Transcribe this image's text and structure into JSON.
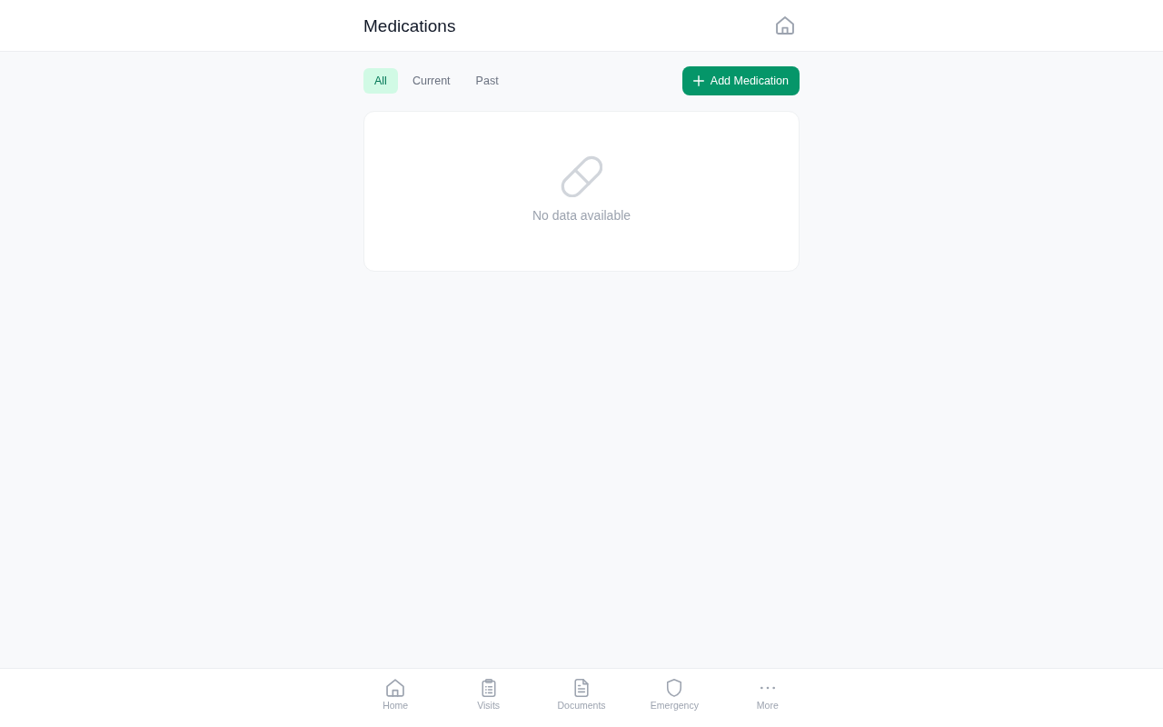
{
  "header": {
    "title": "Medications"
  },
  "filter_tabs": [
    {
      "label": "All",
      "selected": true
    },
    {
      "label": "Current",
      "selected": false
    },
    {
      "label": "Past",
      "selected": false
    }
  ],
  "add_button": {
    "label": "Add Medication"
  },
  "empty_state": {
    "message": "No data available"
  },
  "bottom_nav": [
    {
      "label": "Home",
      "kind": "home",
      "selected": false
    },
    {
      "label": "Visits",
      "kind": "clipboard",
      "selected": false
    },
    {
      "label": "Documents",
      "kind": "document",
      "selected": false
    },
    {
      "label": "Emergency",
      "kind": "shield",
      "selected": false
    },
    {
      "label": "More",
      "kind": "dots",
      "selected": false
    }
  ]
}
